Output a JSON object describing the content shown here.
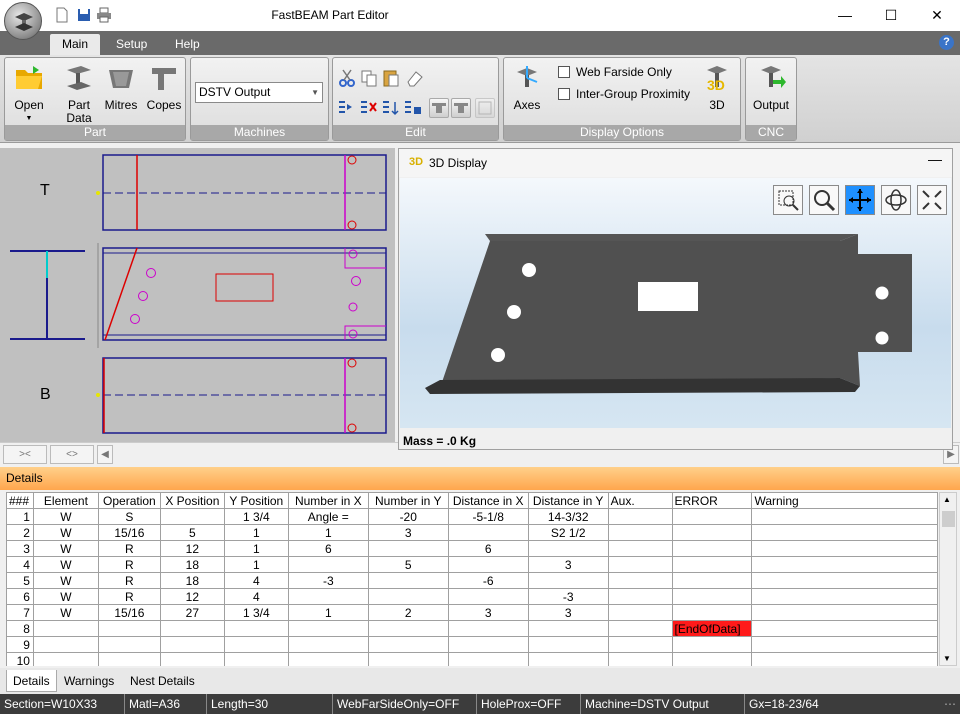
{
  "window": {
    "title": "FastBEAM Part Editor"
  },
  "ribbon": {
    "tabs": [
      {
        "label": "Main"
      },
      {
        "label": "Setup"
      },
      {
        "label": "Help"
      }
    ],
    "groups": {
      "part": {
        "label": "Part",
        "open": "Open",
        "part_data": "Part\nData",
        "mitres": "Mitres",
        "copes": "Copes"
      },
      "machines": {
        "label": "Machines",
        "dropdown_value": "DSTV Output"
      },
      "edit": {
        "label": "Edit"
      },
      "display": {
        "label": "Display Options",
        "axes": "Axes",
        "web_farside": "Web Farside Only",
        "inter_group": "Inter-Group Proximity",
        "three_d": "3D"
      },
      "cnc": {
        "label": "CNC",
        "output": "Output"
      }
    }
  },
  "drawing": {
    "top_label": "T",
    "bottom_label": "B"
  },
  "display3d": {
    "logo": "3D",
    "title": "3D Display",
    "mass": "Mass = .0 Kg"
  },
  "details": {
    "header": "Details",
    "columns": [
      "###",
      "Element",
      "Operation",
      "X Position",
      "Y Position",
      "Number in X",
      "Number in Y",
      "Distance in X",
      "Distance in Y",
      "Aux.",
      "ERROR",
      "Warning"
    ],
    "rows": [
      {
        "n": "1",
        "cells": [
          "W",
          "S",
          "",
          "1 3/4",
          "Angle =",
          "-20",
          "-5-1/8",
          "14-3/32",
          "",
          "",
          ""
        ]
      },
      {
        "n": "2",
        "cells": [
          "W",
          "15/16",
          "5",
          "1",
          "1",
          "3",
          "",
          "S2 1/2",
          "",
          "",
          ""
        ]
      },
      {
        "n": "3",
        "cells": [
          "W",
          "R",
          "12",
          "1",
          "6",
          "",
          "6",
          "",
          "",
          "",
          ""
        ]
      },
      {
        "n": "4",
        "cells": [
          "W",
          "R",
          "18",
          "1",
          "",
          "5",
          "",
          "3",
          "",
          "",
          ""
        ]
      },
      {
        "n": "5",
        "cells": [
          "W",
          "R",
          "18",
          "4",
          "-3",
          "",
          "-6",
          "",
          "",
          "",
          ""
        ]
      },
      {
        "n": "6",
        "cells": [
          "W",
          "R",
          "12",
          "4",
          "",
          "",
          "",
          "-3",
          "",
          "",
          ""
        ]
      },
      {
        "n": "7",
        "cells": [
          "W",
          "15/16",
          "27",
          "1 3/4",
          "1",
          "2",
          "3",
          "3",
          "",
          "",
          ""
        ]
      },
      {
        "n": "8",
        "cells": [
          "",
          "",
          "",
          "",
          "",
          "",
          "",
          "",
          "",
          "[EndOfData]",
          ""
        ]
      },
      {
        "n": "9",
        "cells": [
          "",
          "",
          "",
          "",
          "",
          "",
          "",
          "",
          "",
          "",
          ""
        ]
      },
      {
        "n": "10",
        "cells": [
          "",
          "",
          "",
          "",
          "",
          "",
          "",
          "",
          "",
          "",
          ""
        ]
      }
    ]
  },
  "bottom_tabs": [
    {
      "label": "Details"
    },
    {
      "label": "Warnings"
    },
    {
      "label": "Nest Details"
    }
  ],
  "status": [
    "Section=W10X33",
    "Matl=A36",
    "Length=30",
    "WebFarSideOnly=OFF",
    "HoleProx=OFF",
    "Machine=DSTV Output",
    "Gx=18-23/64"
  ],
  "colors": {
    "accent": "#ffa64d",
    "error": "#ff1a1a",
    "ribbon_tab": "#6a6a6a"
  }
}
